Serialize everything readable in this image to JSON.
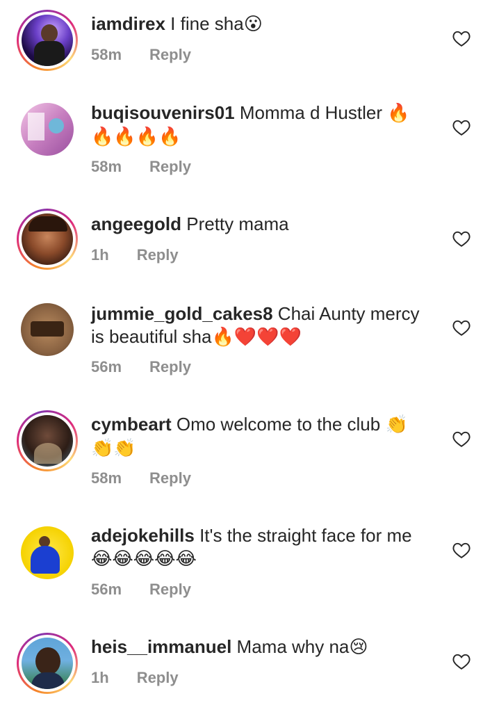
{
  "comments": [
    {
      "username": "iamdirex",
      "text": " I fine sha",
      "emoji": "😮",
      "time": "58m",
      "reply": "Reply"
    },
    {
      "username": "buqisouvenirs01",
      "text": " Momma d Hustler ",
      "emoji": "🔥",
      "emoji2": "🔥🔥🔥🔥",
      "time": "58m",
      "reply": "Reply"
    },
    {
      "username": "angeegold",
      "text": " Pretty mama",
      "emoji": "",
      "time": "1h",
      "reply": "Reply"
    },
    {
      "username": "jummie_gold_cakes8",
      "text": " Chai Aunty mercy",
      "text2": "is beautiful sha",
      "emoji": "🔥❤️❤️❤️",
      "time": "56m",
      "reply": "Reply"
    },
    {
      "username": "cymbeart",
      "text": " Omo welcome to the club ",
      "emoji": "👏",
      "emoji2": "👏👏",
      "time": "58m",
      "reply": "Reply"
    },
    {
      "username": "adejokehills",
      "text": " It's the straight face for me",
      "emoji": "",
      "emoji2": "😂😂😂😂😂",
      "time": "56m",
      "reply": "Reply"
    },
    {
      "username": "heis__immanuel",
      "text": " Mama why na",
      "emoji": "😢",
      "time": "1h",
      "reply": "Reply"
    }
  ],
  "colors": {
    "meta": "#8e8e8e",
    "text": "#262626",
    "ring": "#dd2a7b"
  },
  "icons": {
    "like": "heart-outline-icon"
  }
}
